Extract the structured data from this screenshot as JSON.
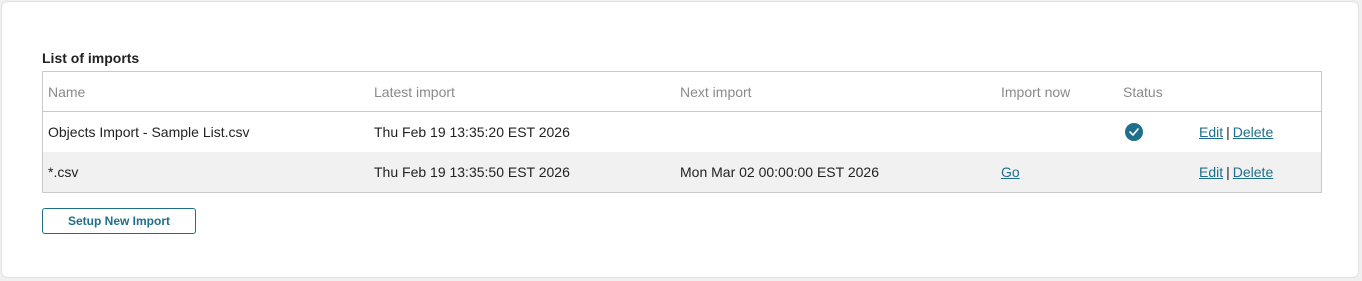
{
  "section": {
    "title": "List of imports"
  },
  "table": {
    "headers": {
      "name": "Name",
      "latest": "Latest import",
      "next": "Next import",
      "import_now": "Import now",
      "status": "Status"
    },
    "rows": [
      {
        "name": "Objects Import - Sample List.csv",
        "latest": "Thu Feb 19 13:35:20 EST 2026",
        "next": "",
        "import_now": "",
        "status_icon": "check-circle-icon",
        "edit": "Edit",
        "separator": "|",
        "delete": "Delete"
      },
      {
        "name": "*.csv",
        "latest": "Thu Feb 19 13:35:50 EST 2026",
        "next": "Mon Mar 02 00:00:00 EST 2026",
        "import_now": "Go",
        "status_icon": "",
        "edit": "Edit",
        "separator": "|",
        "delete": "Delete"
      }
    ]
  },
  "actions": {
    "setup_label": "Setup New Import"
  },
  "colors": {
    "accent": "#1f6f8b",
    "row_alt": "#f1f1f1",
    "border": "#c8c8c8"
  }
}
